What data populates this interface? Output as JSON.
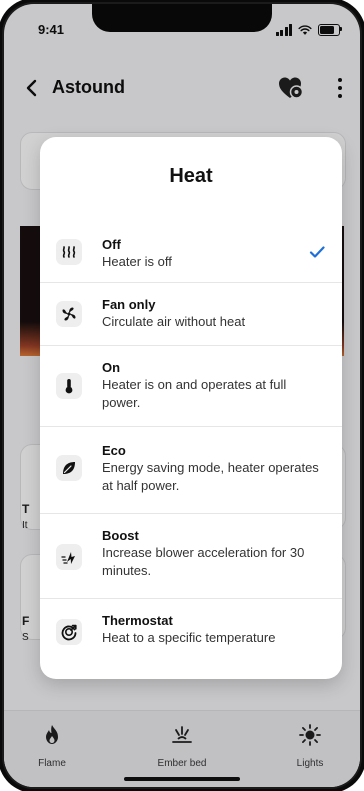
{
  "status_bar": {
    "time": "9:41"
  },
  "app_bar": {
    "title": "Astound"
  },
  "modal": {
    "title": "Heat",
    "options": [
      {
        "icon": "heat-waves-icon",
        "title": "Off",
        "description": "Heater is off",
        "selected": true
      },
      {
        "icon": "fan-icon",
        "title": "Fan only",
        "description": "Circulate air without heat",
        "selected": false
      },
      {
        "icon": "thermometer-icon",
        "title": "On",
        "description": "Heater is on and operates at full power.",
        "selected": false
      },
      {
        "icon": "leaf-icon",
        "title": "Eco",
        "description": "Energy saving mode, heater operates at half power.",
        "selected": false
      },
      {
        "icon": "boost-icon",
        "title": "Boost",
        "description": "Increase blower acceleration for 30 minutes.",
        "selected": false
      },
      {
        "icon": "thermostat-icon",
        "title": "Thermostat",
        "description": "Heat to a specific temperature",
        "selected": false
      }
    ],
    "accent_color": "#1f6fd6"
  },
  "tab_bar": {
    "tabs": [
      {
        "icon": "flame-icon",
        "label": "Flame"
      },
      {
        "icon": "ember-bed-icon",
        "label": "Ember bed"
      },
      {
        "icon": "lights-icon",
        "label": "Lights"
      }
    ]
  },
  "background_fragments": [
    "T",
    "It",
    "F",
    "S"
  ]
}
